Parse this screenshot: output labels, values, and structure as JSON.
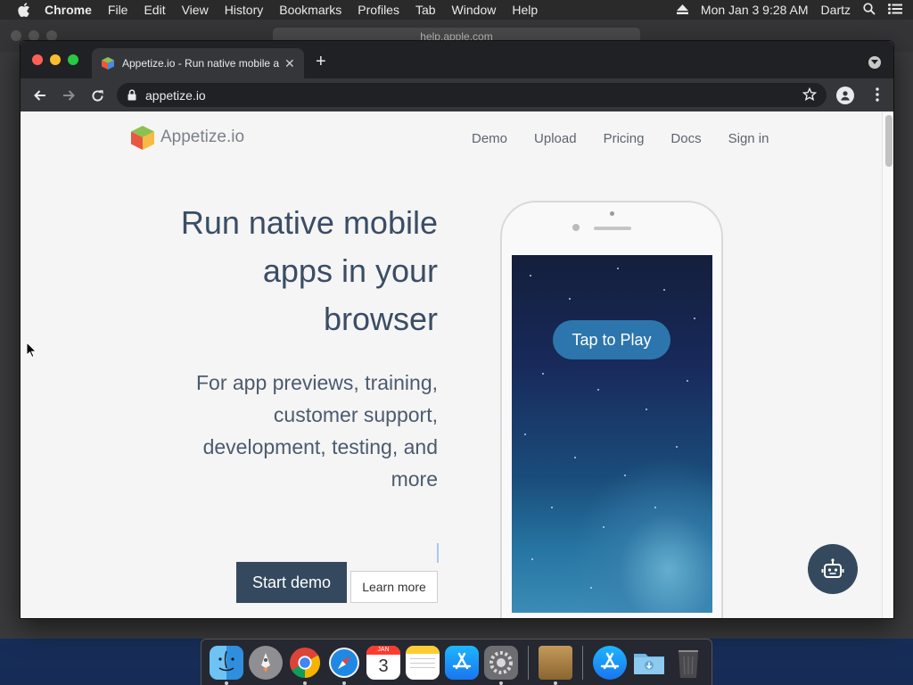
{
  "menubar": {
    "app_name": "Chrome",
    "items": [
      "File",
      "Edit",
      "View",
      "History",
      "Bookmarks",
      "Profiles",
      "Tab",
      "Window",
      "Help"
    ],
    "clock": "Mon Jan 3  9:28 AM",
    "user": "Dartz"
  },
  "background_window": {
    "url": "help.apple.com"
  },
  "browser": {
    "tab_title": "Appetize.io - Run native mobile apps in your browser",
    "address": "appetize.io"
  },
  "site": {
    "brand": "Appetize.io",
    "nav": [
      "Demo",
      "Upload",
      "Pricing",
      "Docs",
      "Sign in"
    ],
    "hero_title": "Run native mobile apps in your browser",
    "hero_subtitle": "For app previews, training, customer support, development, testing, and more",
    "start_demo_label": "Start demo",
    "learn_more_label": "Learn more",
    "tap_to_play_label": "Tap to Play"
  },
  "dock": {
    "calendar_month": "JAN",
    "calendar_day": "3",
    "apps": [
      "finder-icon",
      "launchpad-icon",
      "chrome-icon",
      "safari-icon",
      "calendar-icon",
      "notes-icon",
      "app-store-icon",
      "system-preferences-icon",
      "archive-icon",
      "app-store-folder-icon",
      "downloads-folder-icon",
      "trash-icon"
    ]
  },
  "colors": {
    "menubar_bg": "#2a2a2a",
    "chrome_tabstrip": "#202124",
    "chrome_toolbar": "#35363a",
    "page_bg": "#f5f5f6",
    "primary_button": "#34495e",
    "hero_text": "#3a4d64",
    "tap_to_play": "#2d76ad"
  }
}
